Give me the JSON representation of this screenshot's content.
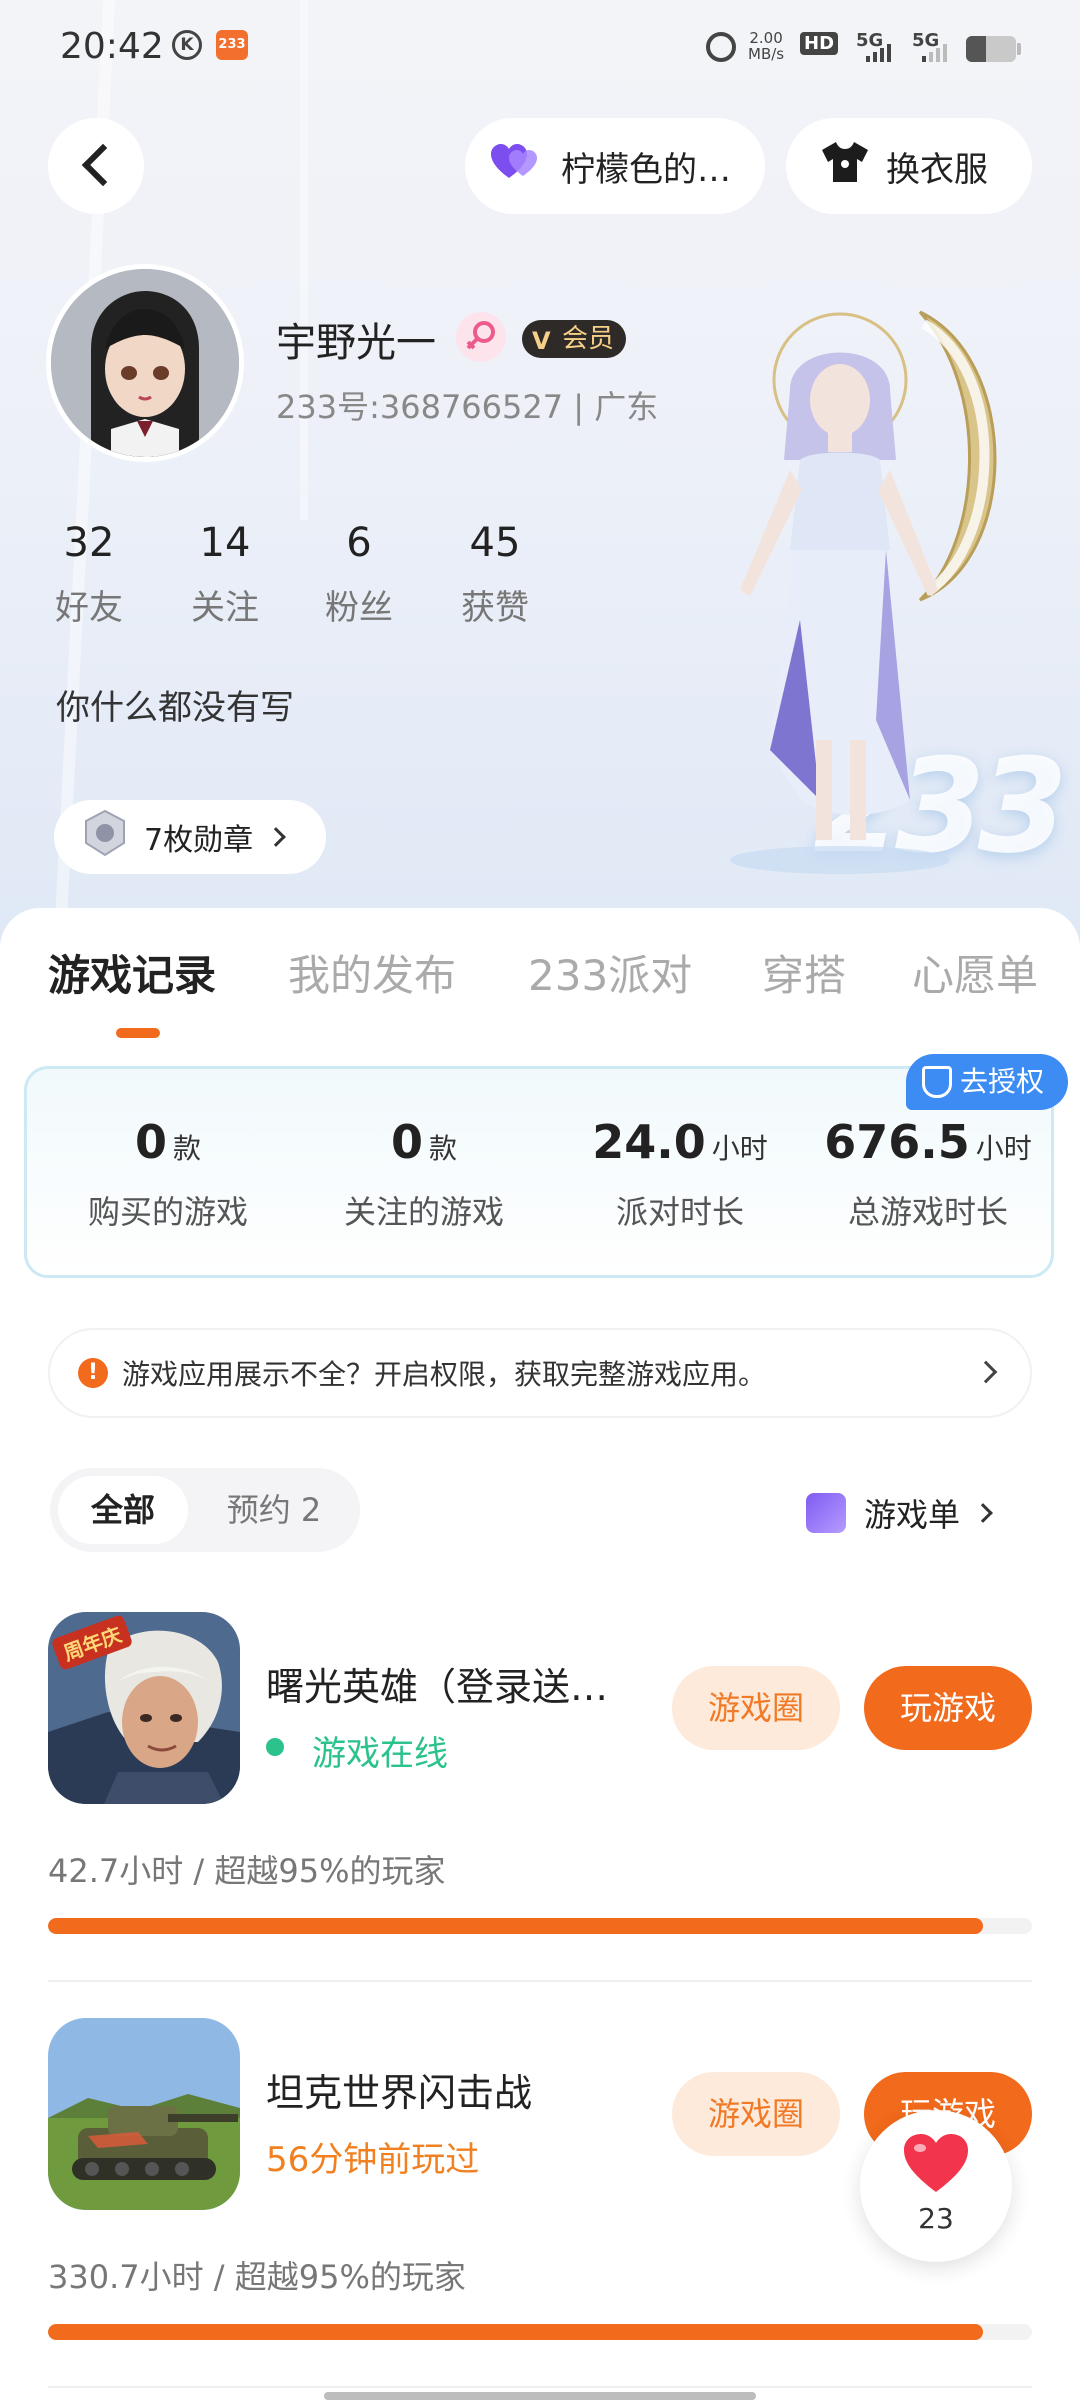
{
  "status_bar": {
    "time": "20:42",
    "speed": "2.00\nMB/s",
    "hd": "HD",
    "net1": "5G",
    "net2": "5G",
    "app_badge": "233"
  },
  "header": {
    "back_icon": "chevron-left-icon",
    "heart_pill_label": "柠檬色的…",
    "clothes_pill_label": "换衣服"
  },
  "profile": {
    "username": "宇野光一",
    "vip_label": "会员",
    "uid_line": "233号:368766527 | 广东",
    "stats": [
      {
        "num": "32",
        "label": "好友"
      },
      {
        "num": "14",
        "label": "关注"
      },
      {
        "num": "6",
        "label": "粉丝"
      },
      {
        "num": "45",
        "label": "获赞"
      }
    ],
    "bio": "你什么都没有写",
    "medal_label": "7枚勋章",
    "decor_text": "233"
  },
  "tabs": [
    {
      "label": "游戏记录",
      "active": true
    },
    {
      "label": "我的发布"
    },
    {
      "label": "233派对"
    },
    {
      "label": "穿搭"
    },
    {
      "label": "心愿单"
    }
  ],
  "summary": {
    "auth_label": "去授权",
    "cells": [
      {
        "value": "0",
        "unit": "款",
        "caption": "购买的游戏"
      },
      {
        "value": "0",
        "unit": "款",
        "caption": "关注的游戏"
      },
      {
        "value": "24.0",
        "unit": "小时",
        "caption": "派对时长"
      },
      {
        "value": "676.5",
        "unit": "小时",
        "caption": "总游戏时长"
      }
    ]
  },
  "notice": {
    "text": "游戏应用展示不全？开启权限，获取完整游戏应用。"
  },
  "filter": {
    "all_label": "全部",
    "reserve_label": "预约 2",
    "gamelist_label": "游戏单"
  },
  "games": [
    {
      "name": "曙光英雄（登录送…",
      "status": "游戏在线",
      "circle_label": "游戏圈",
      "play_label": "玩游戏",
      "hours": "42.7小时 / 超越95%的玩家",
      "progress": 0.95,
      "icon_badge": "周年庆"
    },
    {
      "name": "坦克世界闪击战",
      "status": "56分钟前玩过",
      "circle_label": "游戏圈",
      "play_label": "玩游戏",
      "hours": "330.7小时 / 超越95%的玩家",
      "progress": 0.95
    }
  ],
  "like_fab": {
    "count": "23"
  },
  "colors": {
    "accent": "#f26a1b",
    "online": "#2bc28c",
    "auth_blue": "#3c8cf4"
  }
}
